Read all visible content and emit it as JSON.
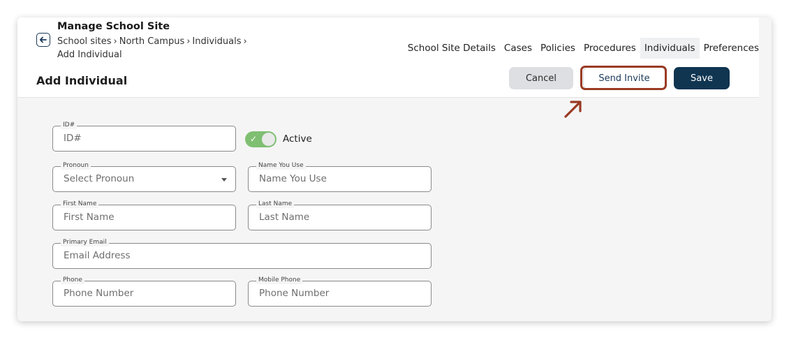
{
  "header": {
    "title": "Manage School Site",
    "breadcrumb": [
      "School sites",
      "North Campus",
      "Individuals",
      "Add Individual"
    ],
    "breadcrumb_separator": "›"
  },
  "tabs": [
    {
      "label": "School Site Details",
      "active": false
    },
    {
      "label": "Cases",
      "active": false
    },
    {
      "label": "Policies",
      "active": false
    },
    {
      "label": "Procedures",
      "active": false
    },
    {
      "label": "Individuals",
      "active": true
    },
    {
      "label": "Preferences",
      "active": false
    }
  ],
  "page": {
    "title": "Add Individual"
  },
  "actions": {
    "cancel": "Cancel",
    "send_invite": "Send Invite",
    "save": "Save"
  },
  "form": {
    "id": {
      "label": "ID#",
      "placeholder": "ID#"
    },
    "active": {
      "label": "Active",
      "on": true
    },
    "pronoun": {
      "label": "Pronoun",
      "placeholder": "Select Pronoun"
    },
    "name_you_use": {
      "label": "Name You Use",
      "placeholder": "Name You Use"
    },
    "first_name": {
      "label": "First Name",
      "placeholder": "First Name"
    },
    "last_name": {
      "label": "Last Name",
      "placeholder": "Last Name"
    },
    "primary_email": {
      "label": "Primary Email",
      "placeholder": "Email Address"
    },
    "phone": {
      "label": "Phone",
      "placeholder": "Phone Number"
    },
    "mobile_phone": {
      "label": "Mobile Phone",
      "placeholder": "Phone Number"
    }
  },
  "colors": {
    "primary": "#0f3551",
    "highlight": "#9a3a23",
    "toggle_on": "#7fbf72"
  },
  "icons": {
    "back": "arrow-left-icon",
    "dropdown": "chevron-down-icon",
    "check": "check-icon",
    "annotation": "arrow-up-right-icon"
  }
}
